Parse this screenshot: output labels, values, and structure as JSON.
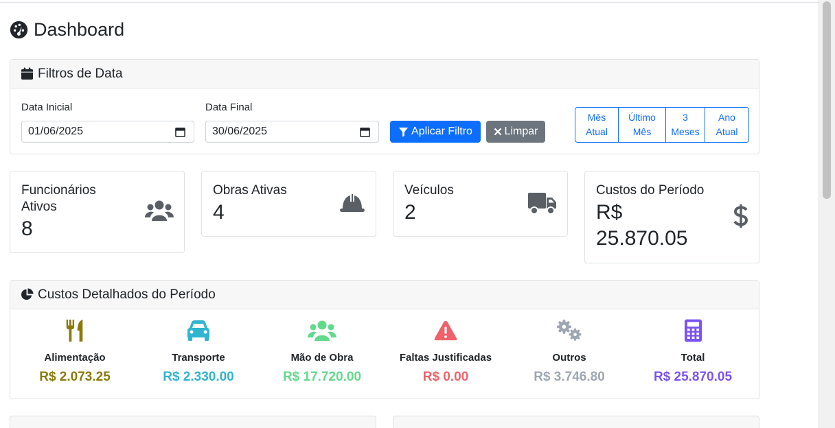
{
  "page": {
    "title": "Dashboard"
  },
  "filters": {
    "header": "Filtros de Data",
    "start_label": "Data Inicial",
    "start_value": "01/06/2025",
    "end_label": "Data Final",
    "end_value": "30/06/2025",
    "apply_label": "Aplicar Filtro",
    "clear_label": "Limpar",
    "quick": [
      {
        "line1": "Mês",
        "line2": "Atual"
      },
      {
        "line1": "Último",
        "line2": "Mês"
      },
      {
        "line1": "3",
        "line2": "Meses"
      },
      {
        "line1": "Ano",
        "line2": "Atual"
      }
    ]
  },
  "stats": {
    "employees": {
      "label_line1": "Funcionários",
      "label_line2": "Ativos",
      "value": "8",
      "icon": "users-icon"
    },
    "works": {
      "label": "Obras Ativas",
      "value": "4",
      "icon": "hard-hat-icon"
    },
    "vehicles": {
      "label": "Veículos",
      "value": "2",
      "icon": "truck-icon"
    },
    "costs": {
      "label": "Custos do Período",
      "value_line1": "R$",
      "value_line2": "25.870.05",
      "icon": "dollar-icon"
    }
  },
  "detailed_costs": {
    "header": "Custos Detalhados do Período",
    "items": [
      {
        "name": "Alimentação",
        "value": "R$ 2.073.25",
        "color": "#8a7a0a",
        "icon": "utensils-icon"
      },
      {
        "name": "Transporte",
        "value": "R$ 2.330.00",
        "color": "#2fb5cf",
        "icon": "car-icon"
      },
      {
        "name": "Mão de Obra",
        "value": "R$ 17.720.00",
        "color": "#63d98b",
        "icon": "users-icon"
      },
      {
        "name": "Faltas Justificadas",
        "value": "R$ 0.00",
        "color": "#f0616a",
        "icon": "warning-icon"
      },
      {
        "name": "Outros",
        "value": "R$ 3.746.80",
        "color": "#9ea6b4",
        "icon": "cogs-icon"
      },
      {
        "name": "Total",
        "value": "R$ 25.870.05",
        "color": "#7b52f0",
        "icon": "calculator-icon"
      }
    ]
  },
  "colors": {
    "primary": "#0d6efd",
    "secondary": "#6c757d",
    "icon_gray": "#5a5f66"
  }
}
